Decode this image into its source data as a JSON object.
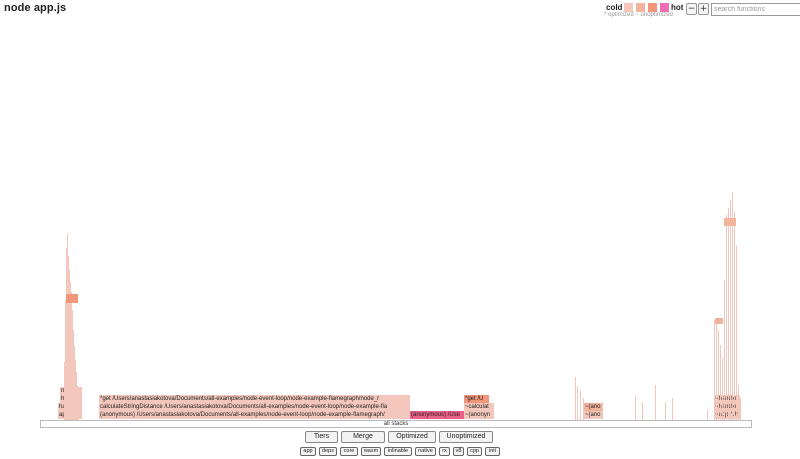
{
  "title": "node app.js",
  "legend": {
    "cold_label": "cold",
    "hot_label": "hot",
    "swatches": [
      "#f3c7bb",
      "#f2b39c",
      "#f0967a",
      "#f06fb3"
    ],
    "note": "* optimized ~ unoptimized"
  },
  "zoom": {
    "minus": "−",
    "plus": "+"
  },
  "search": {
    "placeholder": "search functions",
    "value": ""
  },
  "flamegraph": {
    "root_label": "all stacks",
    "frames": [
      {
        "label": "*get /Users/anastasiakotova/Documents/all-examples/node-event-loop/node-example-flamegraph/node_r"
      },
      {
        "label": "calculateStringDistance /Users/anastasiakotova/Documents/all-examples/node-event-loop/node-example-fla"
      },
      {
        "label": "(anonymous) /Users/anastasiakotova/Documents/all-examples/node-event-loop/node-example-flamegraph/"
      },
      {
        "label": "(anonymous) /Use"
      },
      {
        "label": "*get /U"
      },
      {
        "label": "~calculat"
      },
      {
        "label": "~(anonyn"
      },
      {
        "label": "~(ano"
      },
      {
        "label": "~(ano"
      },
      {
        "label": "next /"
      },
      {
        "label": "handle"
      },
      {
        "label": "handle"
      },
      {
        "label": "app /Ur"
      },
      {
        "label": "~handle"
      },
      {
        "label": "~handle"
      },
      {
        "label": "~app /Ur"
      }
    ]
  },
  "tier_buttons": [
    "Tiers",
    "Merge",
    "Optimized",
    "Unoptimized"
  ],
  "filter_chips": [
    "app",
    "deps",
    "core",
    "wasm",
    "inlinable",
    "native",
    "rx",
    "v8",
    "cpp",
    "init"
  ],
  "colors": {
    "cold": "#f3c7bb",
    "warm": "#f2b39c",
    "hot_orange": "#f0967a",
    "hot_pink": "#ec5f8a"
  }
}
